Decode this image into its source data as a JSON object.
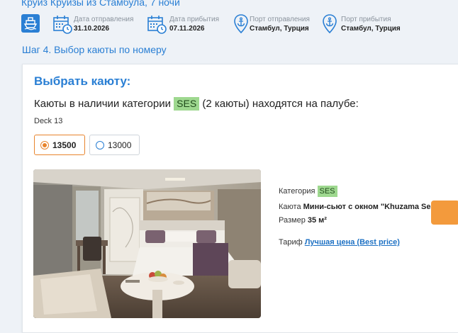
{
  "header": {
    "cruise_title": "Круиз Круизы из Стамбула, 7 ночи",
    "departure_date_label": "Дата отправления",
    "departure_date": "31.10.2026",
    "arrival_date_label": "Дата прибытия",
    "arrival_date": "07.11.2026",
    "departure_port_label": "Порт отправления",
    "departure_port": "Стамбул, Турция",
    "arrival_port_label": "Порт прибытия",
    "arrival_port": "Стамбул, Турция"
  },
  "step": {
    "title": "Шаг 4. Выбор каюты по номеру"
  },
  "card": {
    "title": "Выбрать каюту:",
    "avail_prefix": "Каюты в наличии категории",
    "category": "SES",
    "avail_suffix": "(2 каюты) находятся на палубе:",
    "deck": "Deck 13",
    "cabins": [
      {
        "number": "13500",
        "selected": true
      },
      {
        "number": "13000",
        "selected": false
      }
    ],
    "category_label": "Категория",
    "category_value": "SES",
    "cabin_label": "Каюта",
    "cabin_value": "Мини-сьют с окном \"Khuzama Seaview",
    "size_label": "Размер",
    "size_value": "35 м²",
    "tariff_label": "Тариф",
    "tariff_value": "Лучшая цена (Best price)"
  },
  "colors": {
    "accent": "#2a7fd4",
    "badge_bg": "#9ed88f",
    "selected_border": "#e8842d",
    "button": "#f39a3c"
  }
}
